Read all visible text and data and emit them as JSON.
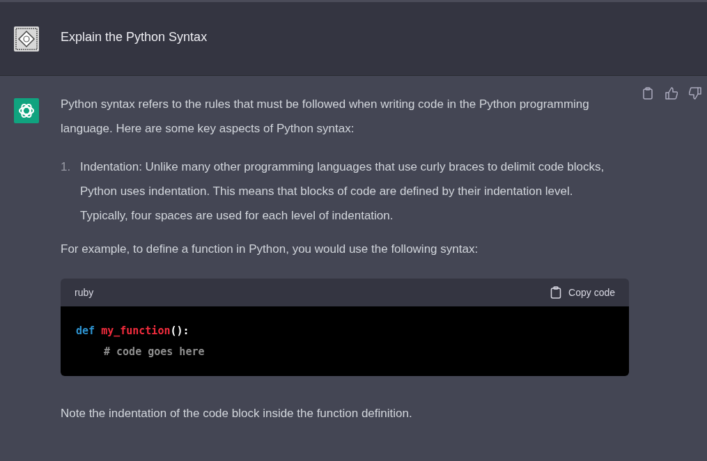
{
  "prompt": {
    "text": "Explain the Python Syntax"
  },
  "answer": {
    "intro": "Python syntax refers to the rules that must be followed when writing code in the Python programming language. Here are some key aspects of Python syntax:",
    "list": [
      {
        "number": "1.",
        "text": "Indentation: Unlike many other programming languages that use curly braces to delimit code blocks, Python uses indentation. This means that blocks of code are defined by their indentation level. Typically, four spaces are used for each level of indentation."
      }
    ],
    "example_intro": "For example, to define a function in Python, you would use the following syntax:",
    "code": {
      "language": "ruby",
      "copy_label": "Copy code",
      "lines": [
        {
          "kind": "top",
          "tokens": [
            {
              "kind": "keyword",
              "text": "def"
            },
            {
              "kind": "function",
              "text": "my_function"
            },
            {
              "kind": "punct",
              "text": "():"
            }
          ]
        },
        {
          "kind": "indented",
          "tokens": [
            {
              "kind": "comment",
              "text": "# code goes here"
            }
          ]
        }
      ]
    },
    "note": "Note the indentation of the code block inside the function definition."
  }
}
